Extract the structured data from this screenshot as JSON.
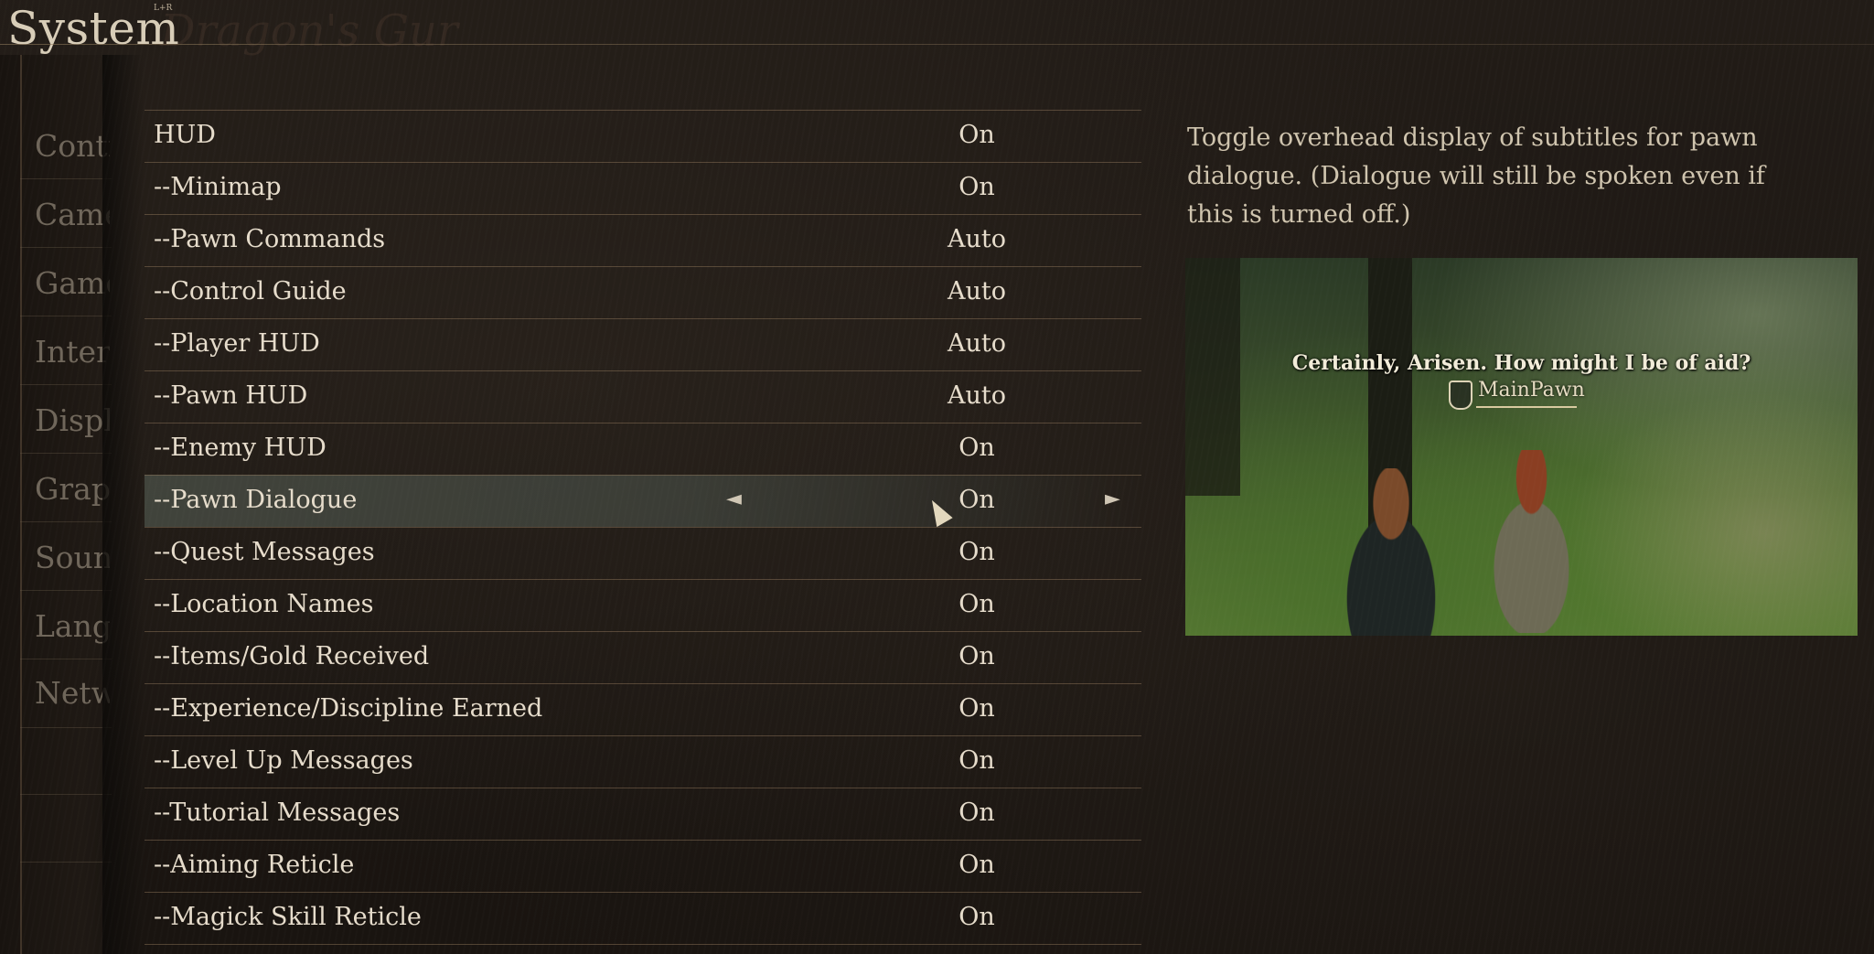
{
  "header": {
    "title": "System",
    "small_text": "L+R",
    "watermark": "Dragon's Gur"
  },
  "sidebar": {
    "items": [
      {
        "label": "Controls"
      },
      {
        "label": "Camera"
      },
      {
        "label": "Game"
      },
      {
        "label": "Interface"
      },
      {
        "label": "Display"
      },
      {
        "label": "Graphics"
      },
      {
        "label": "Sound"
      },
      {
        "label": "Language"
      },
      {
        "label": "Network"
      }
    ]
  },
  "settings": {
    "rows": [
      {
        "label": "HUD",
        "value": "On"
      },
      {
        "label": "--Minimap",
        "value": "On"
      },
      {
        "label": "--Pawn Commands",
        "value": "Auto"
      },
      {
        "label": "--Control Guide",
        "value": "Auto"
      },
      {
        "label": "--Player HUD",
        "value": "Auto"
      },
      {
        "label": "--Pawn HUD",
        "value": "Auto"
      },
      {
        "label": "--Enemy HUD",
        "value": "On"
      },
      {
        "label": "--Pawn Dialogue",
        "value": "On",
        "selected": true
      },
      {
        "label": "--Quest Messages",
        "value": "On"
      },
      {
        "label": "--Location Names",
        "value": "On"
      },
      {
        "label": "--Items/Gold Received",
        "value": "On"
      },
      {
        "label": "--Experience/Discipline Earned",
        "value": "On"
      },
      {
        "label": "--Level Up Messages",
        "value": "On"
      },
      {
        "label": "--Tutorial Messages",
        "value": "On"
      },
      {
        "label": "--Aiming Reticle",
        "value": "On"
      },
      {
        "label": "--Magick Skill Reticle",
        "value": "On"
      }
    ],
    "arrow_left": "◄",
    "arrow_right": "►"
  },
  "description": {
    "text": "Toggle overhead display of subtitles for pawn dialogue. (Dialogue will still be spoken even if this is turned off.)"
  },
  "preview": {
    "subtitle": "Certainly, Arisen. How might I be of aid?",
    "pawn_name": "MainPawn",
    "pawn_icon": "pawn-shield-icon"
  },
  "colors": {
    "text": "#e6dccb",
    "selected_row": "#5a645a",
    "rule": "#967d5f"
  }
}
